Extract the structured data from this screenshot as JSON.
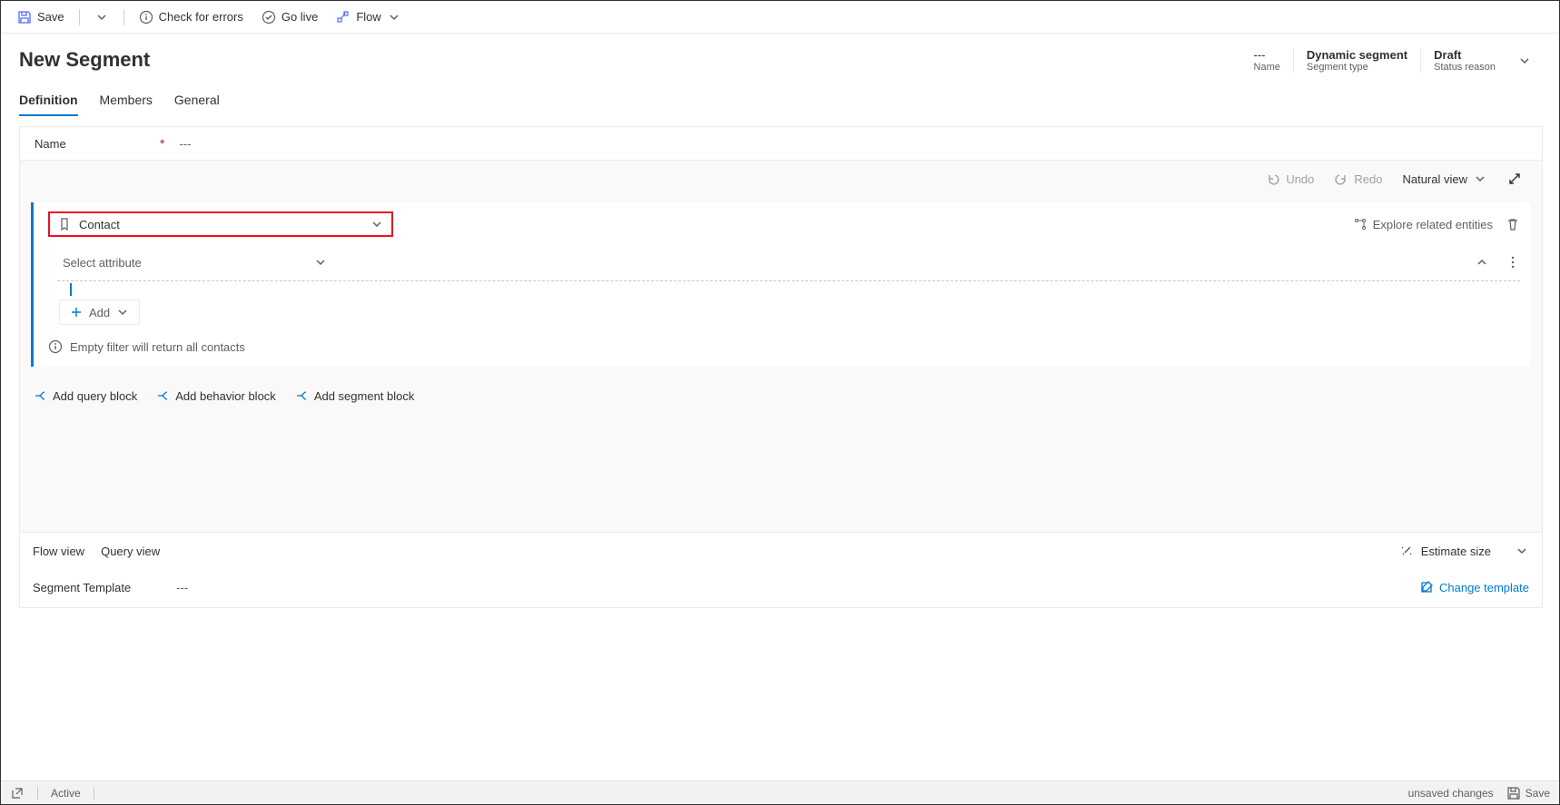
{
  "toolbar": {
    "save": "Save",
    "check_errors": "Check for errors",
    "go_live": "Go live",
    "flow": "Flow"
  },
  "header": {
    "title": "New Segment",
    "status_items": [
      {
        "value": "---",
        "label": "Name"
      },
      {
        "value": "Dynamic segment",
        "label": "Segment type"
      },
      {
        "value": "Draft",
        "label": "Status reason"
      }
    ]
  },
  "tabs": [
    "Definition",
    "Members",
    "General"
  ],
  "name_field": {
    "label": "Name",
    "value": "---"
  },
  "designer_toolbar": {
    "undo": "Undo",
    "redo": "Redo",
    "view_mode": "Natural view"
  },
  "block": {
    "entity": "Contact",
    "explore_related": "Explore related entities",
    "select_attribute": "Select attribute",
    "add": "Add",
    "empty_message": "Empty filter will return all contacts"
  },
  "add_blocks": {
    "query": "Add query block",
    "behavior": "Add behavior block",
    "segment": "Add segment block"
  },
  "views": {
    "flow": "Flow view",
    "query": "Query view",
    "estimate": "Estimate size"
  },
  "template": {
    "label": "Segment Template",
    "value": "---",
    "change": "Change template"
  },
  "footer": {
    "status": "Active",
    "unsaved": "unsaved changes",
    "save": "Save"
  }
}
